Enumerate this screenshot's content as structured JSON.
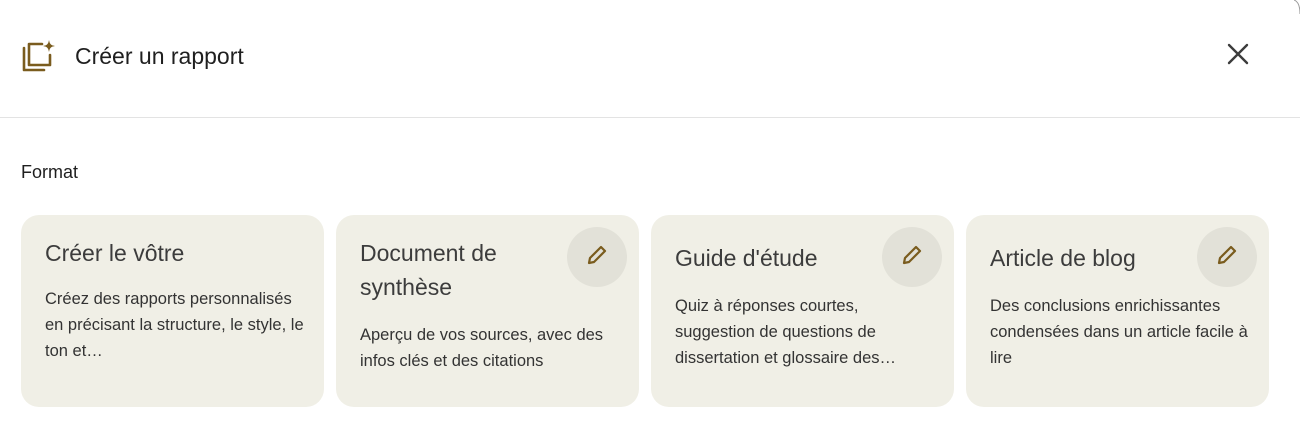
{
  "header": {
    "title": "Créer un rapport",
    "icon": "report-sparkle-icon",
    "close_icon": "close-icon"
  },
  "section": {
    "label": "Format"
  },
  "cards": [
    {
      "title": "Créer le vôtre",
      "description": "Créez des rapports personnalisés en précisant la structure, le style, le ton et…",
      "editable": false
    },
    {
      "title": "Document de synthèse",
      "description": "Aperçu de vos sources, avec des infos clés et des citations",
      "editable": true
    },
    {
      "title": "Guide d'étude",
      "description": "Quiz à réponses courtes, suggestion de questions de dissertation et glossaire des…",
      "editable": true
    },
    {
      "title": "Article de blog",
      "description": "Des conclusions enrichissantes condensées dans un article facile à lire",
      "editable": true
    }
  ],
  "colors": {
    "accent": "#7a5c1e",
    "card_bg": "#f0efe6",
    "edit_btn_bg": "#e2e1d8",
    "divider": "#e3e3e3"
  }
}
